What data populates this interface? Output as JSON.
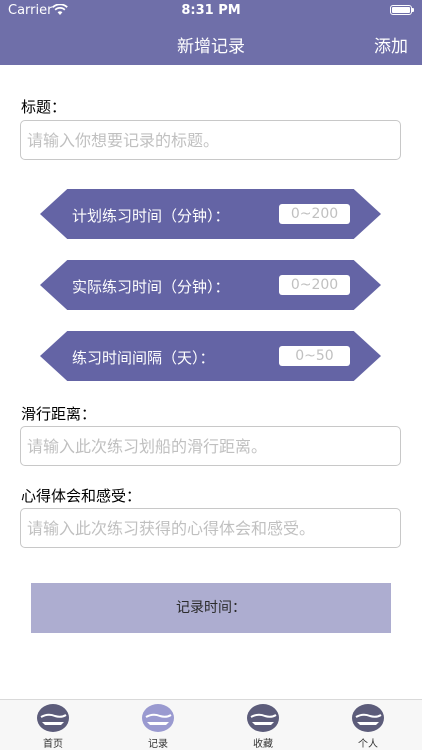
{
  "status_bar": {
    "carrier": "Carrier",
    "time": "8:31 PM"
  },
  "nav": {
    "title": "新增记录",
    "add_label": "添加"
  },
  "form": {
    "title_label": "标题：",
    "title_placeholder": "请输入你想要记录的标题。",
    "pills": [
      {
        "label": "计划练习时间（分钟）：",
        "placeholder": "0~200"
      },
      {
        "label": "实际练习时间（分钟）：",
        "placeholder": "0~200"
      },
      {
        "label": "练习时间间隔（天）：",
        "placeholder": "0~50"
      }
    ],
    "distance_label": "滑行距离：",
    "distance_placeholder": "请输入此次练习划船的滑行距离。",
    "feeling_label": "心得体会和感受：",
    "feeling_placeholder": "请输入此次练习获得的心得体会和感受。",
    "record_time_label": "记录时间："
  },
  "tabbar": {
    "items": [
      {
        "label": "首页",
        "icon": "boat-icon"
      },
      {
        "label": "记录",
        "icon": "boat-icon"
      },
      {
        "label": "收藏",
        "icon": "boat-icon"
      },
      {
        "label": "个人",
        "icon": "boat-icon"
      }
    ],
    "selected_label": "记录"
  },
  "colors": {
    "nav_bg": "#6f6fa9",
    "pill_bg": "#6464a5",
    "record_time_bg": "#adadd0"
  }
}
